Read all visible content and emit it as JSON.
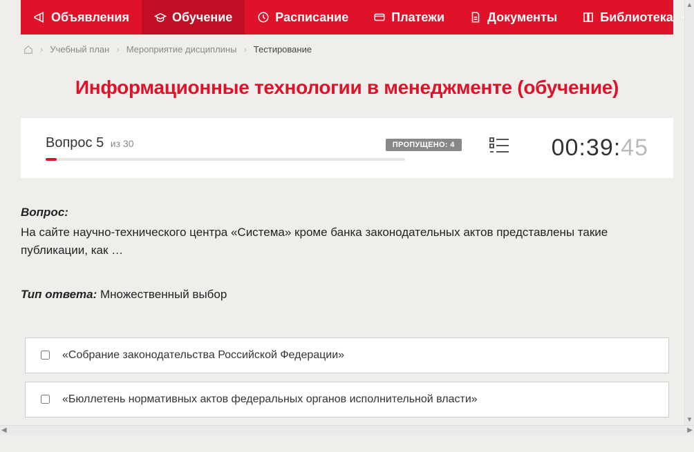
{
  "nav": {
    "items": [
      {
        "label": "Объявления",
        "icon": "megaphone"
      },
      {
        "label": "Обучение",
        "icon": "grad-cap",
        "active": true
      },
      {
        "label": "Расписание",
        "icon": "clock"
      },
      {
        "label": "Платежи",
        "icon": "card"
      },
      {
        "label": "Документы",
        "icon": "doc"
      },
      {
        "label": "Библиотека",
        "icon": "book",
        "dropdown": true
      }
    ]
  },
  "breadcrumb": {
    "items": [
      {
        "label": "Учебный план",
        "link": true
      },
      {
        "label": "Мероприятие дисциплины",
        "link": true
      },
      {
        "label": "Тестирование",
        "current": true
      }
    ]
  },
  "page_title": "Информационные технологии в менеджменте (обучение)",
  "status": {
    "question_label": "Вопрос 5",
    "of_label": "из 30",
    "skipped_label": "ПРОПУЩЕНО: 4",
    "progress_percent": 3,
    "timer_main": "00:39:",
    "timer_seconds": "45"
  },
  "question": {
    "label": "Вопрос:",
    "text": "На сайте научно-технического центра «Система» кроме банка законодательных актов представлены такие публикации, как …"
  },
  "answer_type": {
    "label": "Тип ответа:",
    "value": "Множественный выбор"
  },
  "options": [
    {
      "text": "«Собрание законодательства Российской Федерации»"
    },
    {
      "text": "«Бюллетень нормативных актов федеральных органов исполнительной власти»"
    }
  ]
}
